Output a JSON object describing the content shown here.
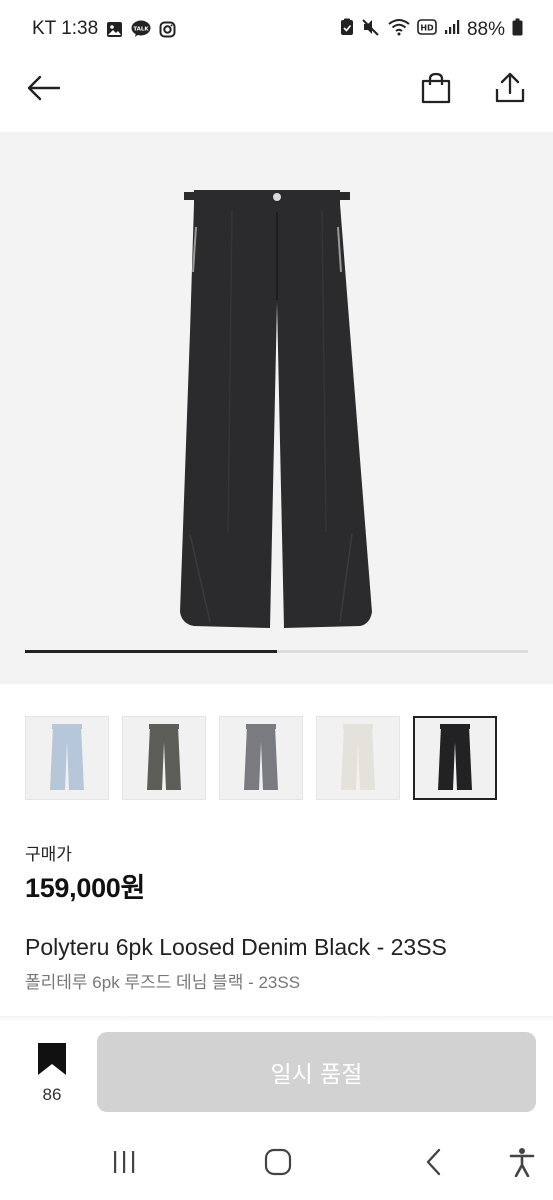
{
  "status_bar": {
    "carrier_time": "KT 1:38",
    "battery": "88%",
    "icons_left": [
      "gallery-icon",
      "kakaotalk-icon",
      "instagram-icon"
    ],
    "icons_right": [
      "clipboard-icon",
      "mute-icon",
      "wifi-icon",
      "hd-icon",
      "signal-icon",
      "battery-icon"
    ]
  },
  "nav": {
    "icons": [
      "back-arrow-icon",
      "shopping-bag-icon",
      "share-icon"
    ]
  },
  "gallery": {
    "progress_fraction": 0.5,
    "colors": {
      "hero_pants": "#2b2b2d",
      "thumb_colors": [
        "#b7c7da",
        "#5d5e58",
        "#7a7b80",
        "#e4e2da",
        "#222224"
      ]
    },
    "selected_thumb": 4
  },
  "product": {
    "price_label": "구매가",
    "price": "159,000원",
    "name_en": "Polyteru 6pk Loosed Denim Black - 23SS",
    "name_ko": "폴리테루 6pk 루즈드 데님 블랙 - 23SS"
  },
  "bottom_bar": {
    "bookmark_count": "86",
    "soldout_label": "일시 품절",
    "soldout_color": "#d2d2d2"
  },
  "system_nav": {
    "icons": [
      "recent-apps-icon",
      "home-icon",
      "back-icon",
      "accessibility-icon"
    ]
  }
}
